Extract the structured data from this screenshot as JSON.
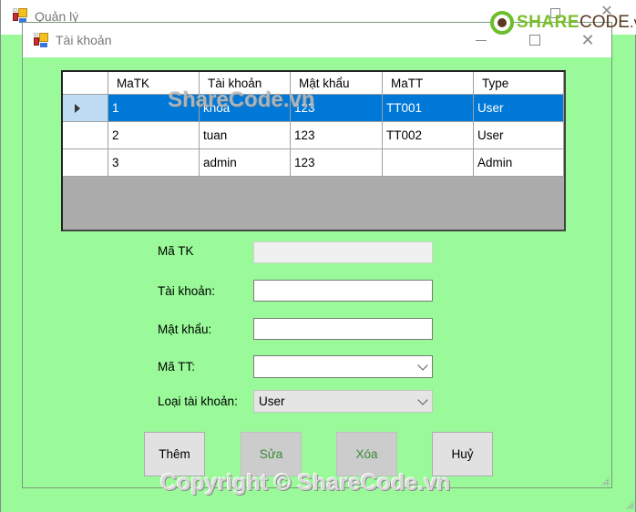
{
  "outer_window": {
    "title": "Quản lý",
    "icon": "app-forms-icon",
    "controls": [
      "minimize",
      "maximize",
      "close"
    ]
  },
  "child_window": {
    "title": "Tài khoản",
    "icon": "app-forms-icon",
    "controls": [
      "minimize",
      "maximize",
      "close"
    ]
  },
  "grid": {
    "columns": [
      "MaTK",
      "Tài khoản",
      "Mật khẩu",
      "MaTT",
      "Type"
    ],
    "rows": [
      {
        "selected": true,
        "cells": [
          "1",
          "khoa",
          "123",
          "TT001",
          "User"
        ]
      },
      {
        "selected": false,
        "cells": [
          "2",
          "tuan",
          "123",
          "TT002",
          "User"
        ]
      },
      {
        "selected": false,
        "cells": [
          "3",
          "admin",
          "123",
          "",
          "Admin"
        ]
      }
    ],
    "selected_row_color": "#0078d7"
  },
  "form": {
    "matk": {
      "label": "Mã TK",
      "value": "",
      "disabled": true
    },
    "taikhoan": {
      "label": "Tài khoản:",
      "value": ""
    },
    "matkhau": {
      "label": "Mật khẩu:",
      "value": ""
    },
    "matt": {
      "label": "Mã TT:",
      "selected": ""
    },
    "loaitk": {
      "label": "Loại tài khoản:",
      "selected": "User"
    }
  },
  "buttons": {
    "add": "Thêm",
    "edit": "Sửa",
    "delete": "Xóa",
    "cancel": "Huỷ"
  },
  "watermarks": {
    "logo_share": "SHARE",
    "logo_code": "CODE",
    "logo_vn": ".vn",
    "middle": "ShareCode.vn",
    "bottom": "Copyright © ShareCode.vn"
  },
  "colors": {
    "form_background": "#9afa9a",
    "disabled_button_text": "#3a8a3a"
  }
}
